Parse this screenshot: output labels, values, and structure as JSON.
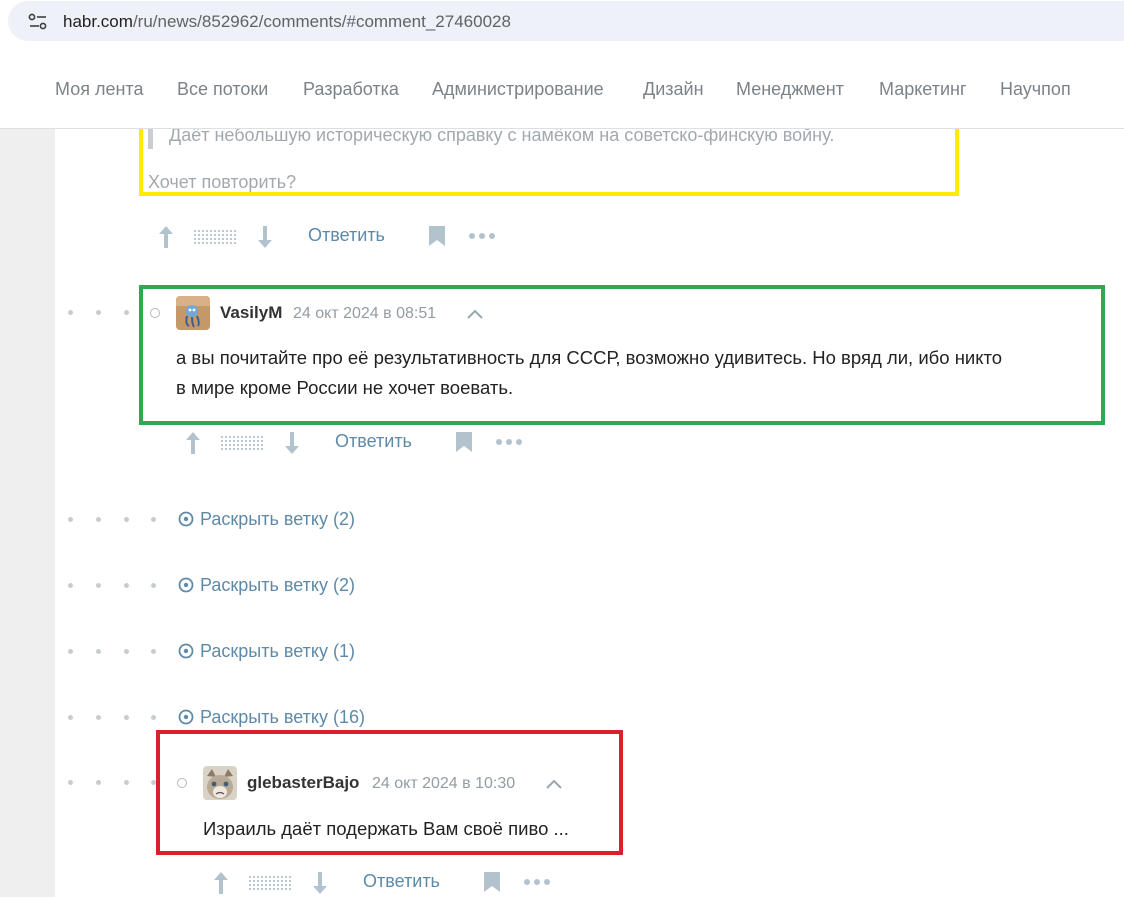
{
  "browser": {
    "url_host": "habr.com",
    "url_path": "/ru/news/852962/comments/#comment_27460028"
  },
  "nav": {
    "items": [
      "Моя лента",
      "Все потоки",
      "Разработка",
      "Администрирование",
      "Дизайн",
      "Менеджмент",
      "Маркетинг",
      "Научпоп"
    ]
  },
  "previous_comment": {
    "quote": "Даёт небольшую историческую справку с намёком на советско-финскую войну.",
    "text": "Хочет повторить?"
  },
  "comments": [
    {
      "author": "VasilyM",
      "timestamp": "24 окт 2024 в 08:51",
      "body_line1": "а вы почитайте про её результативность для СССР, возможно удивитесь. Но вряд ли, ибо никто",
      "body_line2": "в мире кроме России не хочет воевать."
    },
    {
      "author": "glebasterBajo",
      "timestamp": "24 окт 2024 в 10:30",
      "body": "Израиль даёт подержать Вам своё пиво ..."
    }
  ],
  "actions": {
    "reply_label": "Ответить"
  },
  "branches": [
    {
      "label": "Раскрыть ветку (2)"
    },
    {
      "label": "Раскрыть ветку (2)"
    },
    {
      "label": "Раскрыть ветку (1)"
    },
    {
      "label": "Раскрыть ветку (16)"
    }
  ],
  "colors": {
    "highlight_yellow": "#ffeb00",
    "highlight_green": "#2fa84f",
    "highlight_red": "#dc1e2d",
    "link": "#5e8aa8"
  },
  "icons": [
    "site-info-icon",
    "upvote-icon",
    "downvote-icon",
    "bookmark-icon",
    "more-icon",
    "collapse-chevron-icon",
    "expand-branch-icon"
  ]
}
